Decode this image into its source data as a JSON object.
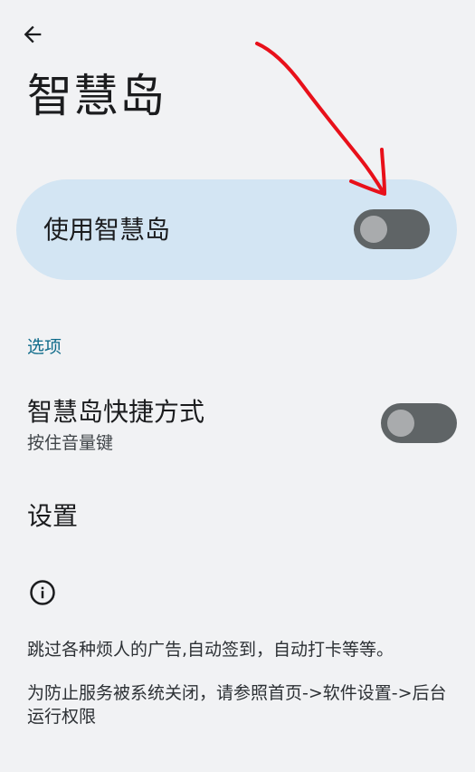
{
  "header": {
    "back_icon": "arrow-left-icon",
    "title": "智慧岛"
  },
  "main_card": {
    "label": "使用智慧岛",
    "switch_on": false
  },
  "options": {
    "section_title": "选项",
    "shortcut": {
      "title": "智慧岛快捷方式",
      "summary": "按住音量键",
      "switch_on": false
    },
    "settings": {
      "title": "设置"
    }
  },
  "footer": {
    "info_icon": "info-icon",
    "line1": "跳过各种烦人的广告,自动签到，自动打卡等等。",
    "line2": "为防止服务被系统关闭，请参照首页->软件设置->后台运行权限"
  },
  "colors": {
    "background": "#f1f2f4",
    "card": "#d3e5f3",
    "accent": "#0f6b8a",
    "switch_off_track": "#5f6466",
    "annotation_red": "#e8101a"
  }
}
